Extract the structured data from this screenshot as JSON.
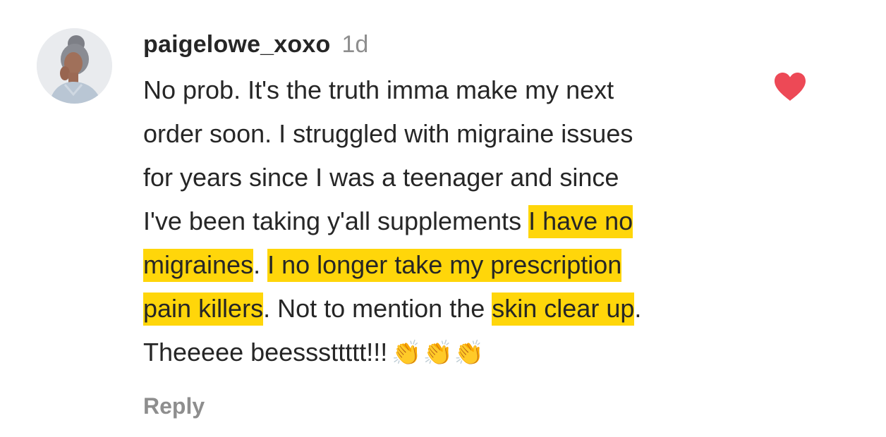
{
  "comment": {
    "username": "paigelowe_xoxo",
    "timestamp": "1d",
    "lines": [
      [
        {
          "text": "No prob. It's the truth imma make my next",
          "highlight": false
        }
      ],
      [
        {
          "text": "order soon. I struggled with migraine issues",
          "highlight": false
        }
      ],
      [
        {
          "text": "for years since I was a teenager and since",
          "highlight": false
        }
      ],
      [
        {
          "text": "I've been taking y'all supplements ",
          "highlight": false
        },
        {
          "text": "I have no",
          "highlight": true
        }
      ],
      [
        {
          "text": "migraines",
          "highlight": true
        },
        {
          "text": ". ",
          "highlight": false
        },
        {
          "text": "I no longer take my prescription",
          "highlight": true
        }
      ],
      [
        {
          "text": "pain killers",
          "highlight": true
        },
        {
          "text": ". Not to mention the ",
          "highlight": false
        },
        {
          "text": "skin clear up",
          "highlight": true
        },
        {
          "text": ".",
          "highlight": false
        }
      ],
      [
        {
          "text": "Theeeee beesssttttt!!!",
          "highlight": false
        }
      ]
    ],
    "emoji": "👏👏👏",
    "reply_label": "Reply",
    "liked": true
  },
  "colors": {
    "highlight": "#ffd60a",
    "heart": "#ed4956",
    "text": "#262626",
    "muted": "#8e8e8e"
  },
  "icons": {
    "avatar": "profile-photo",
    "like": "heart-icon",
    "emoji": "clapping-hands-icon"
  }
}
